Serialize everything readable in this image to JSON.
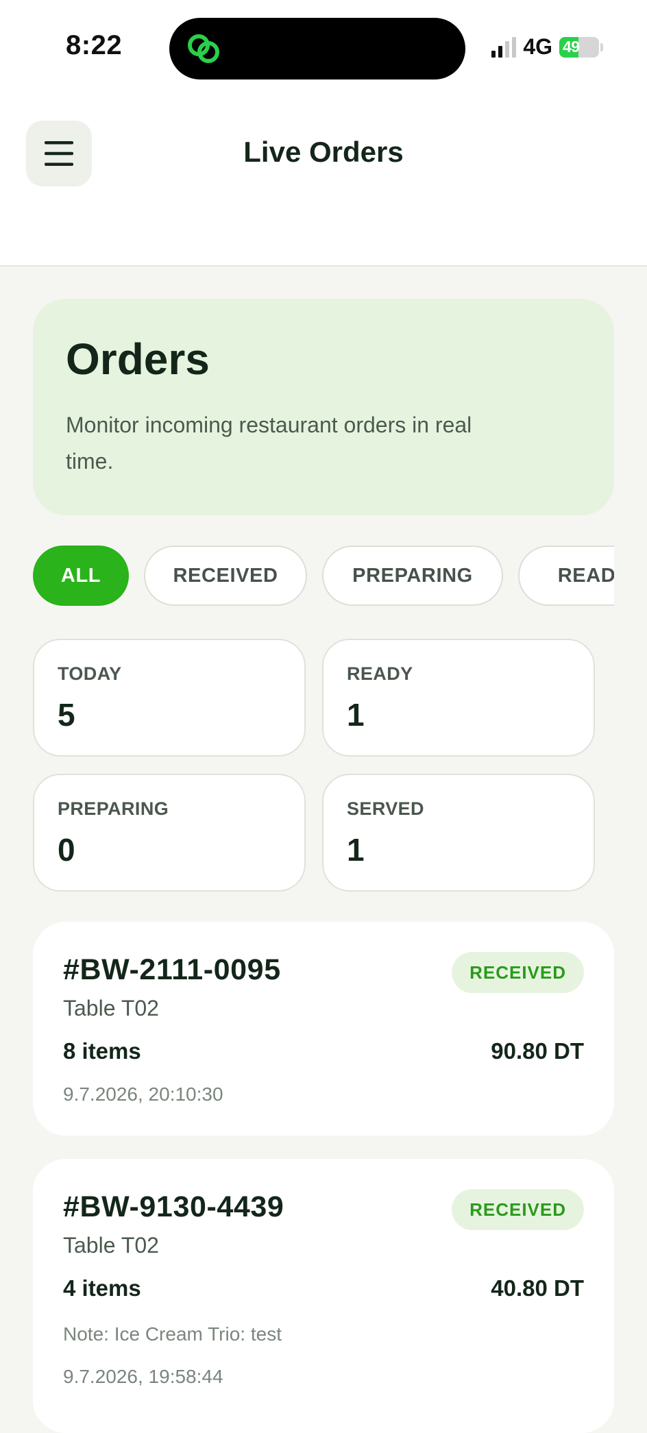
{
  "status_bar": {
    "time": "8:22",
    "network": "4G",
    "battery": "49",
    "battery_level": 0.49
  },
  "header": {
    "title": "Live Orders"
  },
  "hero": {
    "title": "Orders",
    "subtitle": "Monitor incoming restaurant orders in real time."
  },
  "filters": [
    {
      "label": "ALL",
      "active": true
    },
    {
      "label": "RECEIVED",
      "active": false
    },
    {
      "label": "PREPARING",
      "active": false
    },
    {
      "label": "READY",
      "active": false
    }
  ],
  "stats": [
    {
      "label": "TODAY",
      "value": "5"
    },
    {
      "label": "READY",
      "value": "1"
    },
    {
      "label": "PREPARING",
      "value": "0"
    },
    {
      "label": "SERVED",
      "value": "1"
    }
  ],
  "orders": [
    {
      "id": "#BW-2111-0095",
      "status": "RECEIVED",
      "table": "Table T02",
      "items": "8 items",
      "total": "90.80 DT",
      "timestamp": "9.7.2026, 20:10:30"
    },
    {
      "id": "#BW-9130-4439",
      "status": "RECEIVED",
      "table": "Table T02",
      "items": "4 items",
      "total": "40.80 DT",
      "note": "Note: Ice Cream Trio: test",
      "timestamp": "9.7.2026, 19:58:44"
    }
  ],
  "colors": {
    "accent": "#2ab31a",
    "hero_bg": "#e6f4df",
    "badge_text": "#2a9a1c",
    "page_bg": "#f5f6f1"
  }
}
